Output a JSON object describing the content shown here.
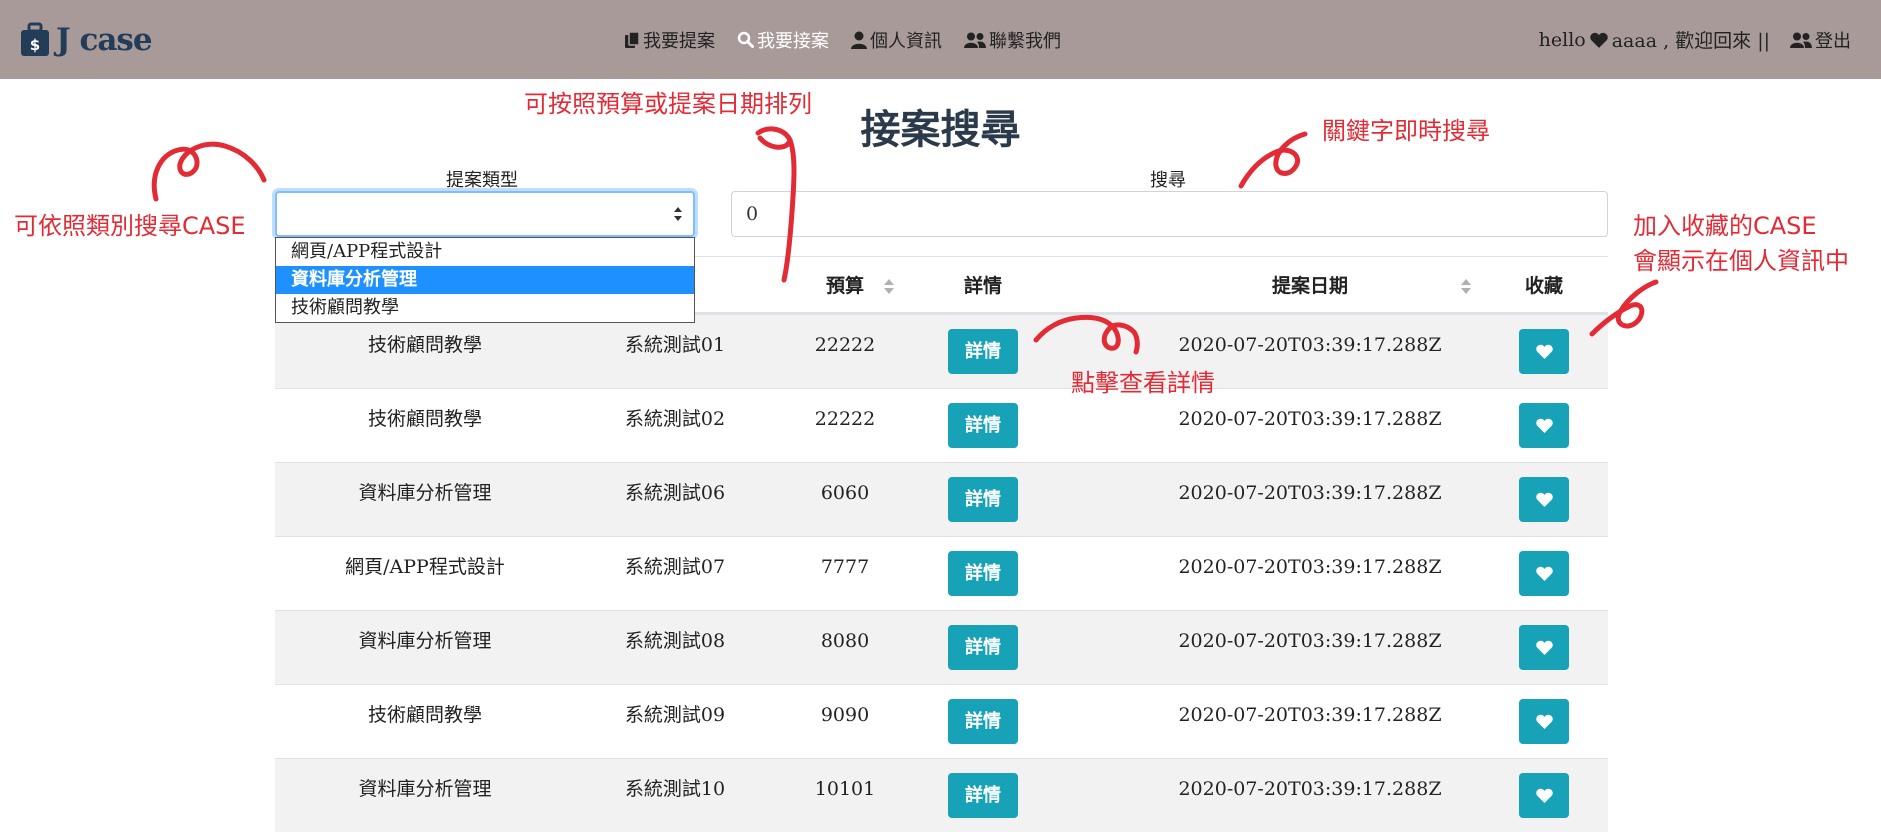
{
  "brand": {
    "name": "J case"
  },
  "nav": {
    "items": [
      {
        "label": "我要提案",
        "icon": "copy-icon"
      },
      {
        "label": "我要接案",
        "icon": "search-icon",
        "active": true
      },
      {
        "label": "個人資訊",
        "icon": "user-icon"
      },
      {
        "label": "聯繫我們",
        "icon": "users-icon"
      }
    ],
    "greeting_prefix": "hello",
    "greeting_suffix": "aaaa , 歡迎回來 ||",
    "logout_label": "登出"
  },
  "page": {
    "title": "接案搜尋"
  },
  "filters": {
    "type_label": "提案類型",
    "type_value": "",
    "type_options": [
      "網頁/APP程式設計",
      "資料庫分析管理",
      "技術顧問教學"
    ],
    "type_selected_index": 1,
    "search_label": "搜尋",
    "search_value": "0"
  },
  "table": {
    "columns": [
      "目",
      "預算",
      "詳情",
      "提案日期",
      "收藏"
    ],
    "sortable": [
      "預算",
      "提案日期"
    ],
    "detail_label": "詳情",
    "rows": [
      {
        "type": "技術顧問教學",
        "name": "系統測試01",
        "budget": "22222",
        "date": "2020-07-20T03:39:17.288Z"
      },
      {
        "type": "技術顧問教學",
        "name": "系統測試02",
        "budget": "22222",
        "date": "2020-07-20T03:39:17.288Z"
      },
      {
        "type": "資料庫分析管理",
        "name": "系統測試06",
        "budget": "6060",
        "date": "2020-07-20T03:39:17.288Z"
      },
      {
        "type": "網頁/APP程式設計",
        "name": "系統測試07",
        "budget": "7777",
        "date": "2020-07-20T03:39:17.288Z"
      },
      {
        "type": "資料庫分析管理",
        "name": "系統測試08",
        "budget": "8080",
        "date": "2020-07-20T03:39:17.288Z"
      },
      {
        "type": "技術顧問教學",
        "name": "系統測試09",
        "budget": "9090",
        "date": "2020-07-20T03:39:17.288Z"
      },
      {
        "type": "資料庫分析管理",
        "name": "系統測試10",
        "budget": "10101",
        "date": "2020-07-20T03:39:17.288Z"
      }
    ]
  },
  "annotations": {
    "category": "可依照類別搜尋CASE",
    "sort": "可按照預算或提案日期排列",
    "keyword": "關鍵字即時搜尋",
    "detail": "點擊查看詳情",
    "favorite_line1": "加入收藏的CASE",
    "favorite_line2": "會顯示在個人資訊中"
  },
  "colors": {
    "navbar": "#a99a9a",
    "brand": "#233d58",
    "button": "#17a2b8",
    "annotation": "#e32b36",
    "dropdown_highlight": "#1e90ff"
  }
}
